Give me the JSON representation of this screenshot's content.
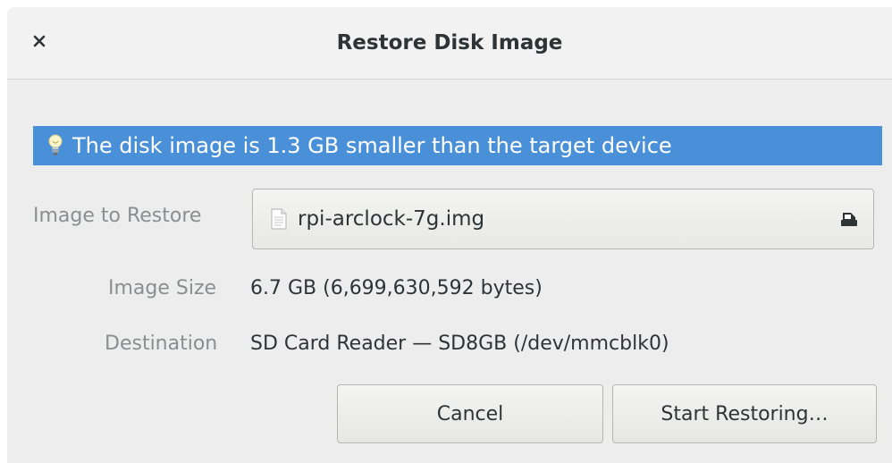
{
  "dialog": {
    "title": "Restore Disk Image",
    "close_icon": "close-icon"
  },
  "info_bar": {
    "icon": "lightbulb-icon",
    "message": "The disk image is 1.3 GB smaller than the target device",
    "color": "#4a90d9"
  },
  "form": {
    "image_to_restore": {
      "label": "Image to Restore",
      "file_name": "rpi-arclock-7g.img",
      "file_icon": "document-icon",
      "eject_icon": "eject-icon"
    },
    "image_size": {
      "label": "Image Size",
      "value": "6.7 GB (6,699,630,592 bytes)"
    },
    "destination": {
      "label": "Destination",
      "value": "SD Card Reader — SD8GB (/dev/mmcblk0)"
    }
  },
  "buttons": {
    "cancel": "Cancel",
    "start": "Start Restoring…"
  }
}
